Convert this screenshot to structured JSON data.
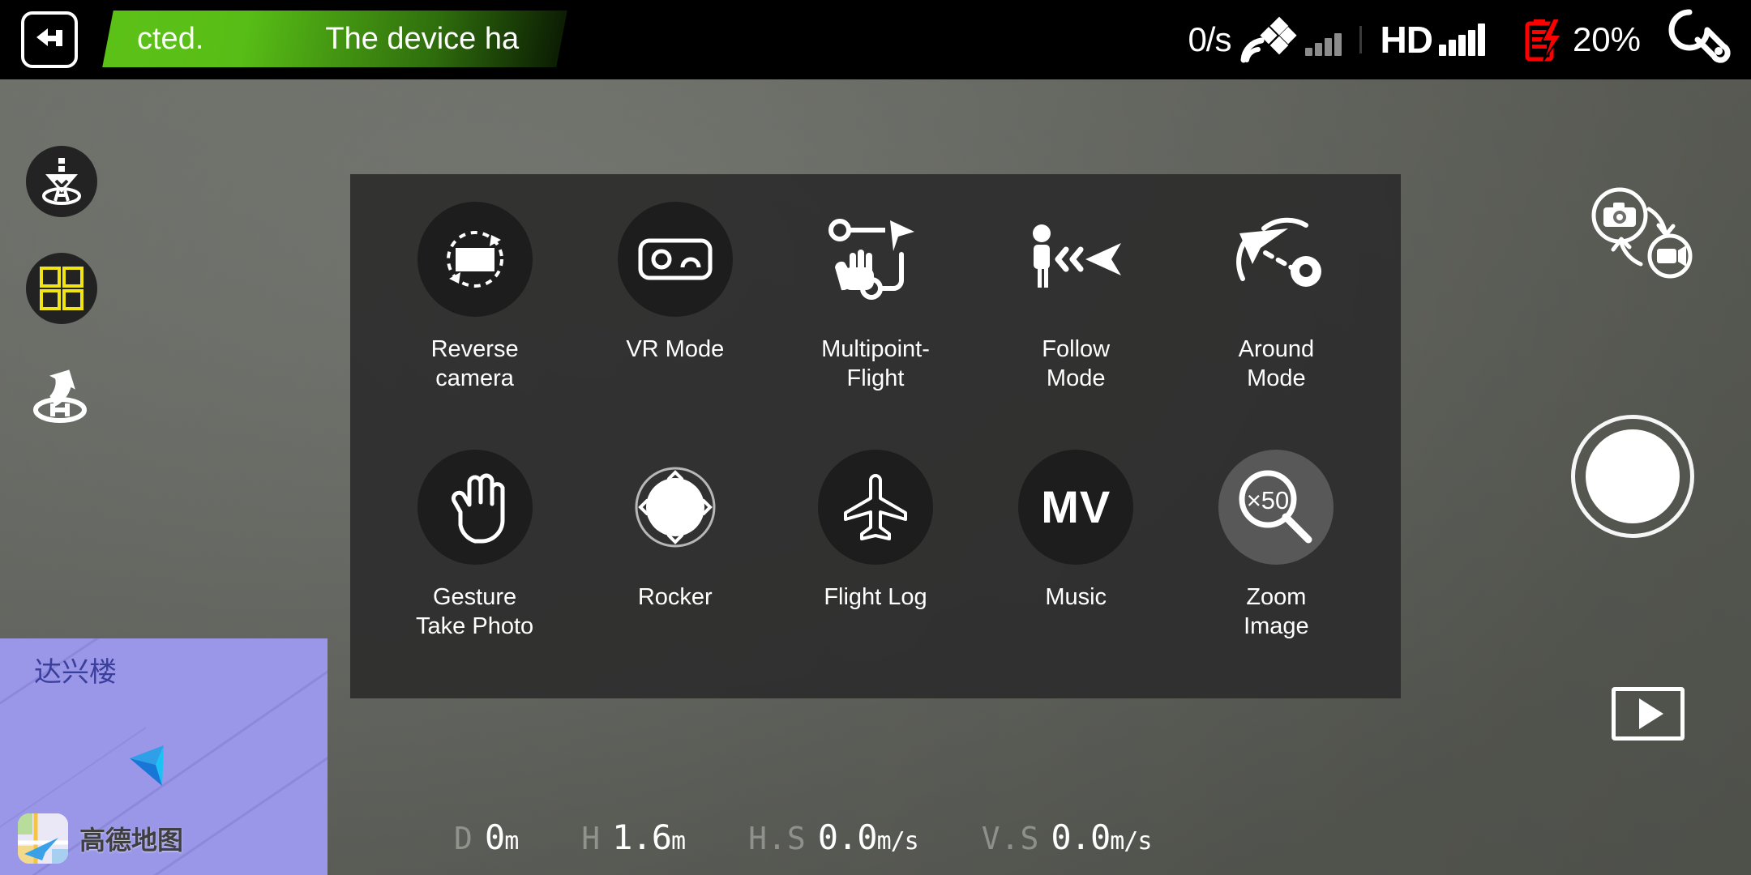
{
  "statusbar": {
    "back_icon": "back-arrow-icon",
    "banner_text_fragment_1": "cted.",
    "banner_text_fragment_2": "The device ha",
    "banner_color": "#5cc117",
    "upload_speed": "0/s",
    "satellite_icon": "satellite-icon",
    "satellite_bars": [
      10,
      16,
      22,
      28
    ],
    "satellite_bars_active": 0,
    "hd_label": "HD",
    "hd_bars": [
      14,
      20,
      26,
      32,
      40
    ],
    "battery_icon": "battery-icon",
    "battery_color": "#ff0000",
    "battery_percent": "20%",
    "settings_icon": "wrench-icon"
  },
  "left_rail": {
    "items": [
      {
        "name": "takeoff-landing",
        "icon": "landing-pad-icon",
        "style": "dark"
      },
      {
        "name": "menu-grid",
        "icon": "grid-squares-icon",
        "style": "dark",
        "color": "#f2e516"
      },
      {
        "name": "return-to-home",
        "icon": "return-home-icon",
        "style": "plain"
      }
    ]
  },
  "right_rail": {
    "mode_swap_icon": "camera-video-swap-icon",
    "shutter_button": "shutter-button",
    "playback_icon": "play-icon"
  },
  "menu_panel": {
    "items": [
      {
        "label": "Reverse\ncamera",
        "icon": "reverse-camera-icon",
        "style": "dark"
      },
      {
        "label": "VR Mode",
        "icon": "vr-goggles-icon",
        "style": "dark"
      },
      {
        "label": "Multipoint-\nFlight",
        "icon": "waypoint-flight-icon",
        "style": "flat"
      },
      {
        "label": "Follow\nMode",
        "icon": "follow-person-icon",
        "style": "flat"
      },
      {
        "label": "Around\nMode",
        "icon": "orbit-point-icon",
        "style": "flat"
      },
      {
        "label": "Gesture\nTake Photo",
        "icon": "open-hand-icon",
        "style": "dark"
      },
      {
        "label": "Rocker",
        "icon": "joystick-icon",
        "style": "flat"
      },
      {
        "label": "Flight Log",
        "icon": "airplane-icon",
        "style": "dark"
      },
      {
        "label": "Music",
        "icon": "mv-text-icon",
        "style": "dark",
        "text": "MV"
      },
      {
        "label": "Zoom\nImage",
        "icon": "magnifier-x50-icon",
        "style": "highlight",
        "text": "×50"
      }
    ]
  },
  "telemetry": [
    {
      "key": "D",
      "value": "0",
      "unit": "m"
    },
    {
      "key": "H",
      "value": "1.6",
      "unit": "m"
    },
    {
      "key": "H.S",
      "value": "0.0",
      "unit": "m/s"
    },
    {
      "key": "V.S",
      "value": "0.0",
      "unit": "m/s"
    }
  ],
  "map": {
    "place_label": "达兴楼",
    "provider_name": "高德地图",
    "marker_icon": "drone-heading-arrow",
    "map_color": "#9a97e8"
  }
}
